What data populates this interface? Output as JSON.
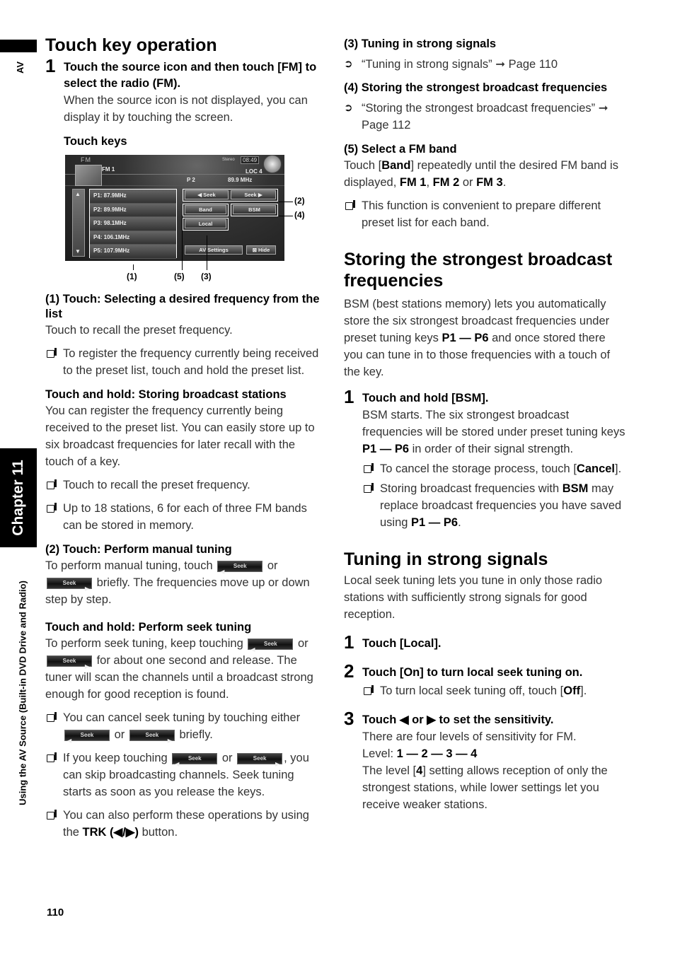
{
  "side": {
    "section_tab": "AV",
    "chapter": "Chapter 11",
    "caption": "Using the AV Source (Built-in DVD Drive and Radio)"
  },
  "page_number": "110",
  "left": {
    "heading": "Touch key operation",
    "step1": {
      "num": "1",
      "title": "Touch the source icon and then touch [FM] to select the radio (FM).",
      "body": "When the source icon is not displayed, you can display it by touching the screen."
    },
    "touch_keys_label": "Touch keys",
    "screen": {
      "source": "FM",
      "stereo": "Stereo",
      "clock": "08:49",
      "band": "FM 1",
      "loc": "LOC 4",
      "preset": "P 2",
      "frequency": "89.9  MHz",
      "presets": [
        "P1: 87.9MHz",
        "P2: 89.9MHz",
        "P3: 98.1MHz",
        "P4: 106.1MHz",
        "P5: 107.9MHz"
      ],
      "keys": {
        "seek_left": "◀  Seek",
        "seek_right": "Seek  ▶",
        "band": "Band",
        "bsm": "BSM",
        "local": "Local",
        "av_settings": "AV Settings",
        "hide": "⊠ Hide"
      },
      "callouts": [
        "(1)",
        "(2)",
        "(3)",
        "(4)",
        "(5)"
      ]
    },
    "s1": {
      "title": "(1) Touch: Selecting a desired frequency from the list",
      "body": "Touch to recall the preset frequency.",
      "note": "To register the frequency currently being received to the preset list, touch and hold the preset list."
    },
    "s_hold_store": {
      "title": "Touch and hold: Storing broadcast stations",
      "body": "You can register the frequency currently being received to the preset list. You can easily store up to six broadcast frequencies for later recall with the touch of a key.",
      "notes": [
        "Touch to recall the preset frequency.",
        "Up to 18 stations, 6 for each of three FM bands can be stored in memory."
      ]
    },
    "s2": {
      "title": "(2) Touch: Perform manual tuning",
      "body_a": "To perform manual tuning, touch",
      "or": "or",
      "body_b": "briefly. The frequencies move up or down step by step."
    },
    "s_hold_seek": {
      "title": "Touch and hold: Perform seek tuning",
      "body_a": "To perform seek tuning, keep touching",
      "or": "or",
      "body_b": "for about one second and release. The tuner will scan the channels until a broadcast strong enough for good reception is found.",
      "note1_a": "You can cancel seek tuning by touching either",
      "note1_b": "briefly.",
      "note2_a": "If you keep touching",
      "note2_b": ", you can skip broadcasting channels. Seek tuning starts as soon as you release the keys.",
      "note3_a": "You can also perform these operations by using the",
      "note3_bold": "TRK (◀/▶)",
      "note3_b": "button."
    },
    "seek_label": "Seek"
  },
  "right": {
    "s3": {
      "title": "(3) Tuning in strong signals",
      "ref": "“Tuning in strong signals” ➞ Page 110"
    },
    "s4": {
      "title": "(4) Storing the strongest broadcast frequencies",
      "ref": "“Storing the strongest broadcast frequencies” ➞ Page 112"
    },
    "s5": {
      "title": "(5) Select a FM band",
      "body_a": "Touch [",
      "band": "Band",
      "body_b": "] repeatedly until the desired FM band is displayed, ",
      "fm1": "FM 1",
      "comma": ", ",
      "fm2": "FM 2",
      "or": " or ",
      "fm3": "FM 3",
      "period": ".",
      "note": "This function is convenient to prepare different preset list for each band."
    },
    "bsm": {
      "heading": "Storing the strongest broadcast frequencies",
      "body_a": "BSM (best stations memory) lets you automatically store the six strongest broadcast frequencies under preset tuning keys ",
      "range": "P1 — P6",
      "body_b": " and once stored there you can tune in to those frequencies with a touch of the key.",
      "step1_num": "1",
      "step1_title": "Touch and hold [BSM].",
      "step1_body_a": "BSM starts. The six strongest broadcast frequencies will be stored under preset tuning keys ",
      "step1_body_b": " in order of their signal strength.",
      "note1_a": "To cancel the storage process, touch [",
      "cancel": "Cancel",
      "note1_b": "].",
      "note2_a": "Storing broadcast frequencies with ",
      "bsm": "BSM",
      "note2_b": " may replace broadcast frequencies you have saved using ",
      "note2_c": "."
    },
    "tuning": {
      "heading": "Tuning in strong signals",
      "body": "Local seek tuning lets you tune in only those radio stations with sufficiently strong signals for good reception.",
      "step1_num": "1",
      "step1_title": "Touch [Local].",
      "step2_num": "2",
      "step2_title": "Touch [On] to turn local seek tuning on.",
      "step2_note_a": "To turn local seek tuning off, touch [",
      "off": "Off",
      "step2_note_b": "].",
      "step3_num": "3",
      "step3_title": "Touch ◀ or ▶ to set the sensitivity.",
      "step3_body1": "There are four levels of sensitivity for FM.",
      "level_label": "Level: ",
      "levels": "1 — 2 — 3 — 4",
      "step3_body2_a": "The level [",
      "level4": "4",
      "step3_body2_b": "] setting allows reception of only the strongest stations, while lower settings let you receive weaker stations."
    }
  }
}
